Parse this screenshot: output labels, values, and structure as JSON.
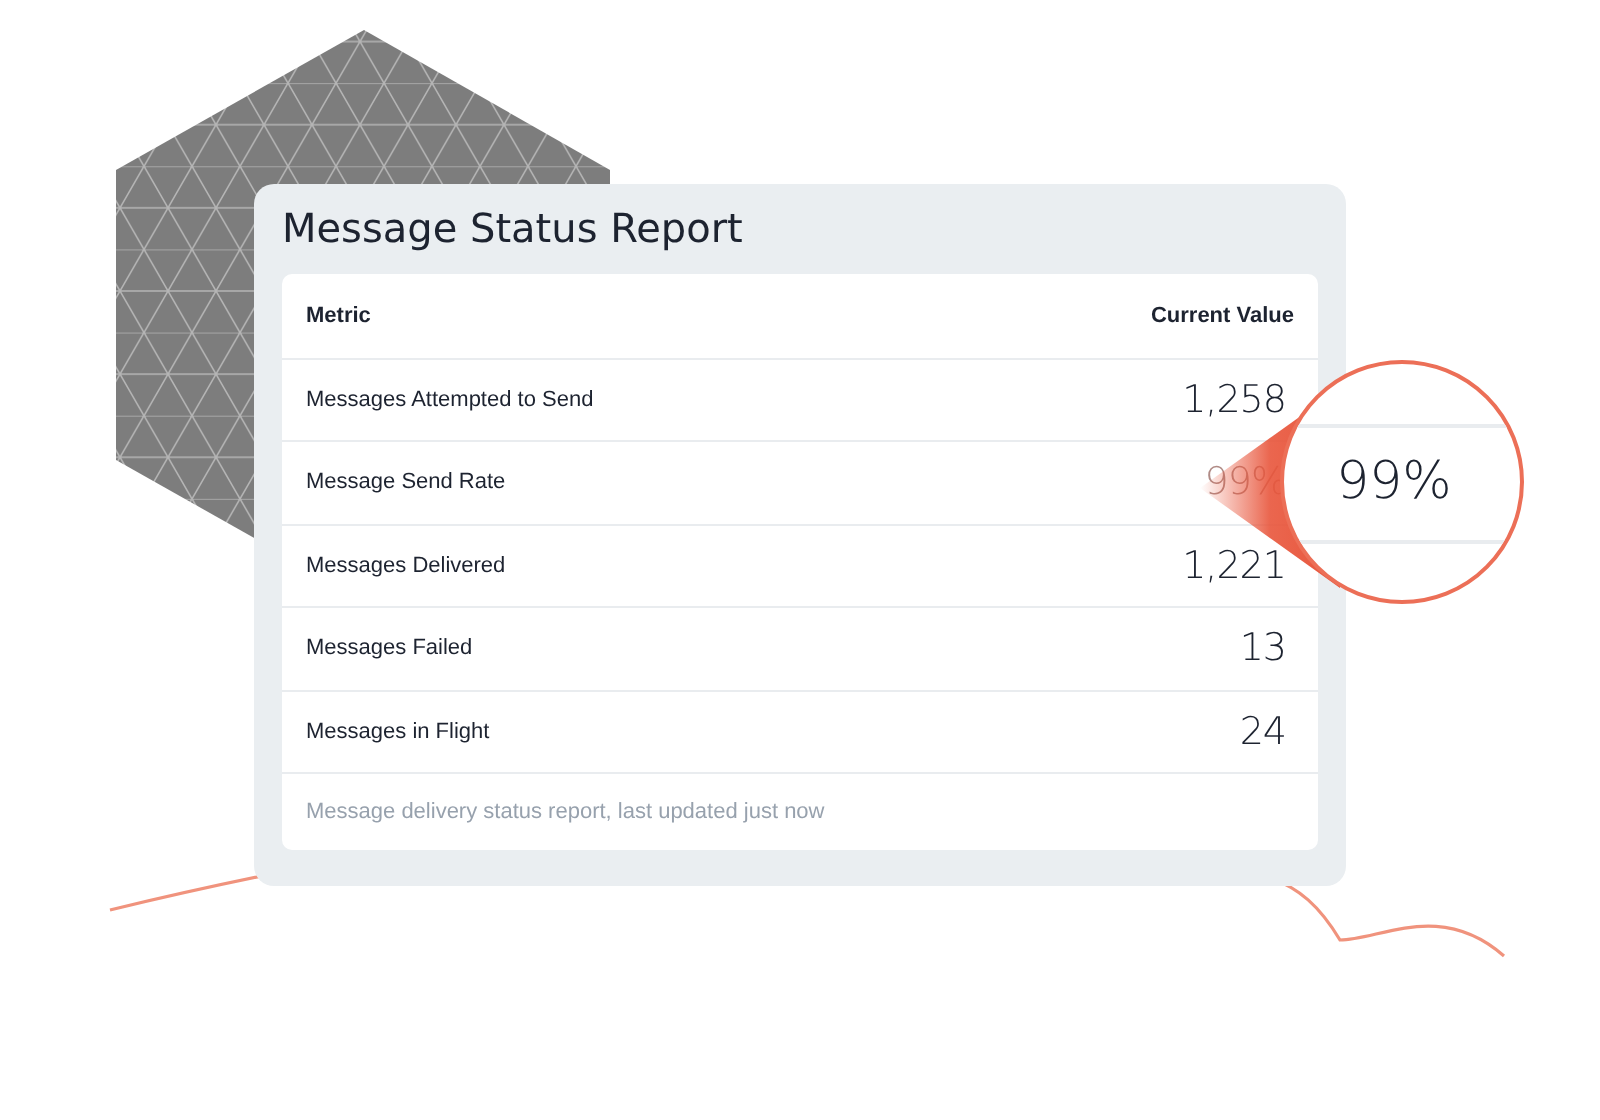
{
  "report": {
    "title": "Message Status Report",
    "columns": [
      "Metric",
      "Current Value"
    ],
    "rows": [
      {
        "metric": "Messages Attempted to Send",
        "value": "1,258",
        "highlighted": false
      },
      {
        "metric": "Message Send Rate",
        "value": "99%",
        "highlighted": true
      },
      {
        "metric": "Messages Delivered",
        "value": "1,221",
        "highlighted": false
      },
      {
        "metric": "Messages Failed",
        "value": "13",
        "highlighted": false
      },
      {
        "metric": "Messages in Flight",
        "value": "24",
        "highlighted": false
      }
    ],
    "caption": "Message delivery status report, last updated just now"
  },
  "magnifier": {
    "value": "99%"
  }
}
